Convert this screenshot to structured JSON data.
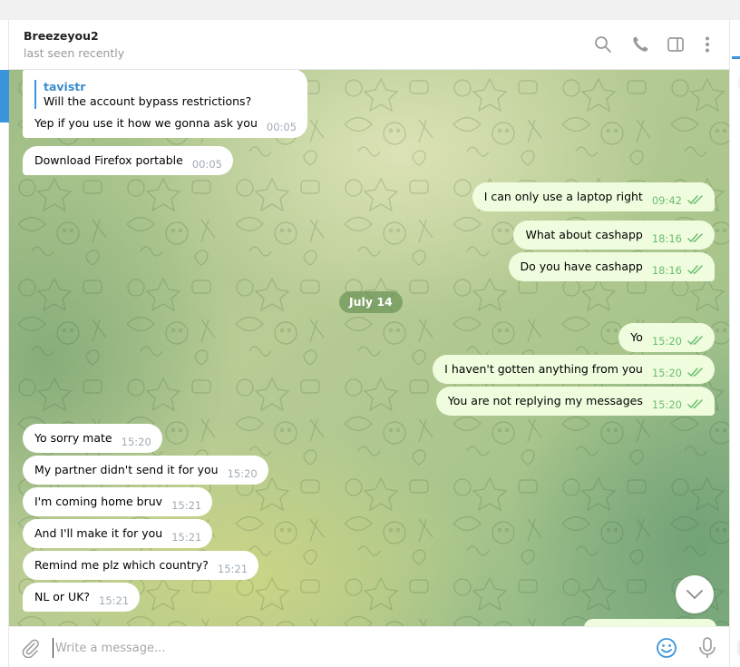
{
  "header": {
    "title": "Breezeyou2",
    "status": "last seen recently",
    "icons": [
      "search-icon",
      "phone-icon",
      "sidebar-toggle-icon",
      "more-vertical-icon"
    ]
  },
  "date_separator": "July 14",
  "messages": [
    {
      "direction": "incoming",
      "reply_to": {
        "name": "tavistr",
        "text": "Will the account bypass restrictions?"
      },
      "text": "Yep if you use it how we gonna ask you",
      "time": "00:05"
    },
    {
      "direction": "incoming",
      "text": "Download Firefox portable",
      "time": "00:05"
    },
    {
      "direction": "outgoing",
      "text": "I can only use a laptop right",
      "time": "09:42",
      "status": "read"
    },
    {
      "direction": "outgoing",
      "text": "What about cashapp",
      "time": "18:16",
      "status": "read"
    },
    {
      "direction": "outgoing",
      "text": "Do you have cashapp",
      "time": "18:16",
      "status": "read"
    },
    {
      "direction": "outgoing",
      "text": "Yo",
      "time": "15:20",
      "status": "read"
    },
    {
      "direction": "outgoing",
      "text": "I haven't  gotten anything from you",
      "time": "15:20",
      "status": "read"
    },
    {
      "direction": "outgoing",
      "text": "You are not replying my messages",
      "time": "15:20",
      "status": "read"
    },
    {
      "direction": "incoming",
      "text": "Yo sorry mate",
      "time": "15:20"
    },
    {
      "direction": "incoming",
      "text": "My partner didn't send it for you",
      "time": "15:20"
    },
    {
      "direction": "incoming",
      "text": "I'm coming home bruv",
      "time": "15:21"
    },
    {
      "direction": "incoming",
      "text": "And I'll make it for you",
      "time": "15:21"
    },
    {
      "direction": "incoming",
      "text": "Remind me plz which country?",
      "time": "15:21"
    },
    {
      "direction": "incoming",
      "text": "NL or UK?",
      "time": "15:21"
    }
  ],
  "composer": {
    "placeholder": "Write a message...",
    "value": ""
  },
  "colors": {
    "accent": "#3a95dd",
    "incoming_bubble": "#ffffff",
    "outgoing_bubble": "#effdde",
    "outgoing_time": "#6dbc72",
    "incoming_time": "#a0acb6"
  }
}
